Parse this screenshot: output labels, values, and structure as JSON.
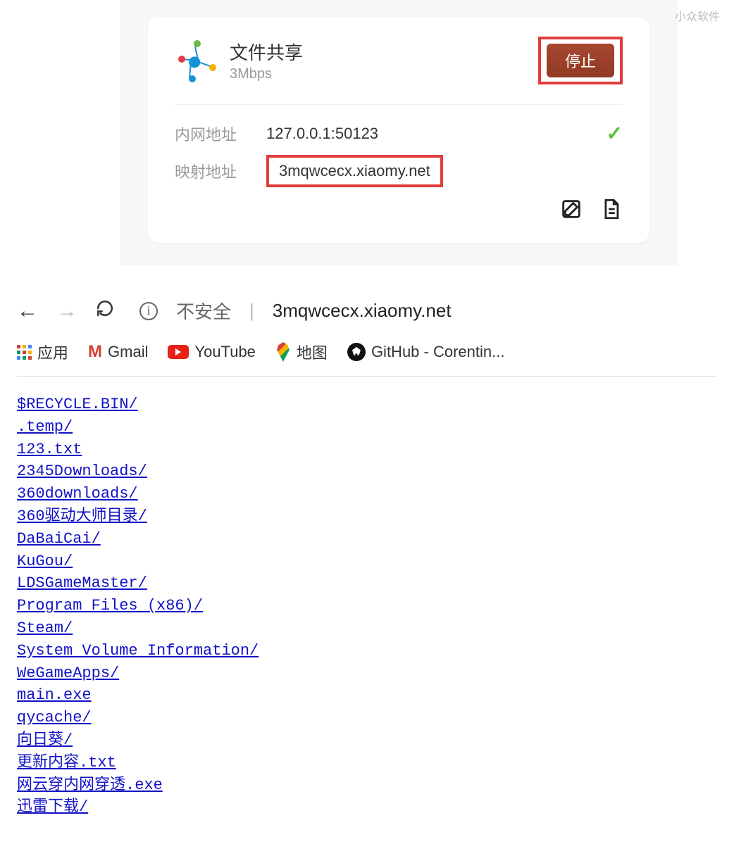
{
  "watermark": "小众软件",
  "card": {
    "title": "文件共享",
    "speed": "3Mbps",
    "stop_label": "停止",
    "lan_label": "内网地址",
    "lan_value": "127.0.0.1:50123",
    "map_label": "映射地址",
    "map_value": "3mqwcecx.xiaomy.net"
  },
  "browser": {
    "insecure": "不安全",
    "url": "3mqwcecx.xiaomy.net",
    "bookmarks": {
      "apps": "应用",
      "gmail": "Gmail",
      "youtube": "YouTube",
      "maps": "地图",
      "github": "GitHub - Corentin..."
    },
    "files": [
      "$RECYCLE.BIN/",
      ".temp/",
      "123.txt",
      "2345Downloads/",
      "360downloads/",
      "360驱动大师目录/",
      "DaBaiCai/",
      "KuGou/",
      "LDSGameMaster/",
      "Program Files (x86)/",
      "Steam/",
      "System Volume Information/",
      "WeGameApps/",
      "main.exe",
      "qycache/",
      "向日葵/",
      "更新内容.txt",
      "网云穿内网穿透.exe",
      "迅雷下载/"
    ]
  }
}
